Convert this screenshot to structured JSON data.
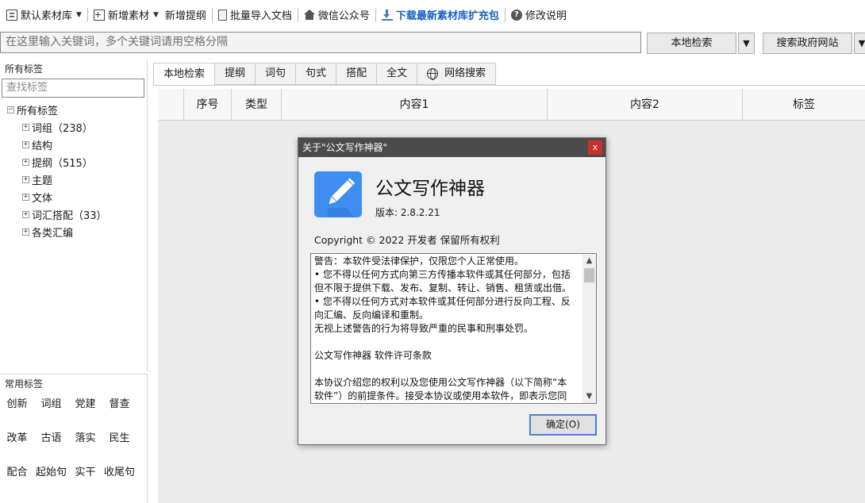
{
  "toolbar": {
    "default_library": "默认素材库",
    "new_material": "新增素材",
    "new_outline": "新增提纲",
    "batch_import": "批量导入文档",
    "wechat": "微信公众号",
    "download": "下载最新素材库扩充包",
    "help": "修改说明",
    "help_glyph": "?"
  },
  "search": {
    "placeholder": "在这里输入关键词，多个关键词请用空格分隔",
    "local_button": "本地检索",
    "gov_button": "搜索政府网站",
    "dropdown_glyph": "▼"
  },
  "left": {
    "all_tags_title": "所有标签",
    "tag_search_placeholder": "查找标签",
    "root": "所有标签",
    "root_toggle": "−",
    "child_toggle": "+",
    "items": [
      {
        "label": "词组（238）"
      },
      {
        "label": "结构"
      },
      {
        "label": "提纲（515）"
      },
      {
        "label": "主题"
      },
      {
        "label": "文体"
      },
      {
        "label": "词汇搭配（33）"
      },
      {
        "label": "各类汇编"
      }
    ],
    "common_title": "常用标签",
    "common_tags": [
      "创新",
      "词组",
      "党建",
      "督查",
      "改革",
      "古语",
      "落实",
      "民生",
      "配合",
      "起始句",
      "实干",
      "收尾句"
    ]
  },
  "tabs": [
    "本地检索",
    "提纲",
    "词句",
    "句式",
    "搭配",
    "全文",
    "网络搜索"
  ],
  "grid": {
    "columns": [
      "序号",
      "类型",
      "内容1",
      "内容2",
      "标签"
    ]
  },
  "about": {
    "title": "关于\"公文写作神器\"",
    "close": "x",
    "app_name": "公文写作神器",
    "version": "版本:  2.8.2.21",
    "copyright": "Copyright © 2022  开发者 保留所有权利",
    "license_lines": [
      "警告：本软件受法律保护，仅限您个人正常使用。",
      "• 您不得以任何方式向第三方传播本软件或其任何部分，包括",
      "但不限于提供下载、发布、复制、转让、销售、租赁或出借。",
      "• 您不得以任何方式对本软件或其任何部分进行反向工程、反",
      "向汇编、反向编译和重制。",
      "无视上述警告的行为将导致严重的民事和刑事处罚。",
      "",
      "公文写作神器 软件许可条款",
      "",
      "本协议介绍您的权利以及您使用公文写作神器（以下简称“本",
      "软件”）的前提条件。接受本协议或使用本软件，即表示您同"
    ],
    "ok": "确定(O)",
    "scroll_up": "▲",
    "scroll_down": "▼"
  },
  "colors": {
    "accent": "#1560bd",
    "icon_blue": "#3d8ef0",
    "title_bar": "#4b4b4b",
    "close_red": "#c9302c"
  }
}
